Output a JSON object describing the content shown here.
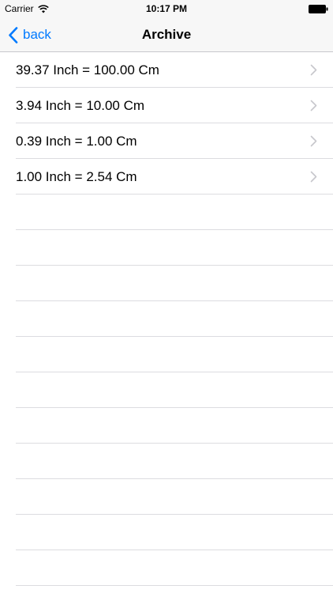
{
  "status_bar": {
    "carrier": "Carrier",
    "time": "10:17 PM",
    "wifi_icon": "wifi-icon",
    "battery_icon": "battery-icon"
  },
  "nav_bar": {
    "back_label": "back",
    "back_icon": "chevron-left-icon",
    "title": "Archive"
  },
  "archive": {
    "items": [
      {
        "label": "39.37 Inch = 100.00 Cm"
      },
      {
        "label": "3.94 Inch = 10.00 Cm"
      },
      {
        "label": "0.39 Inch = 1.00 Cm"
      },
      {
        "label": "1.00 Inch = 2.54 Cm"
      }
    ],
    "accessory_icon": "chevron-right-icon"
  },
  "colors": {
    "accent": "#007aff",
    "separator": "#dcdce0",
    "bar_background": "#f7f7f7"
  }
}
